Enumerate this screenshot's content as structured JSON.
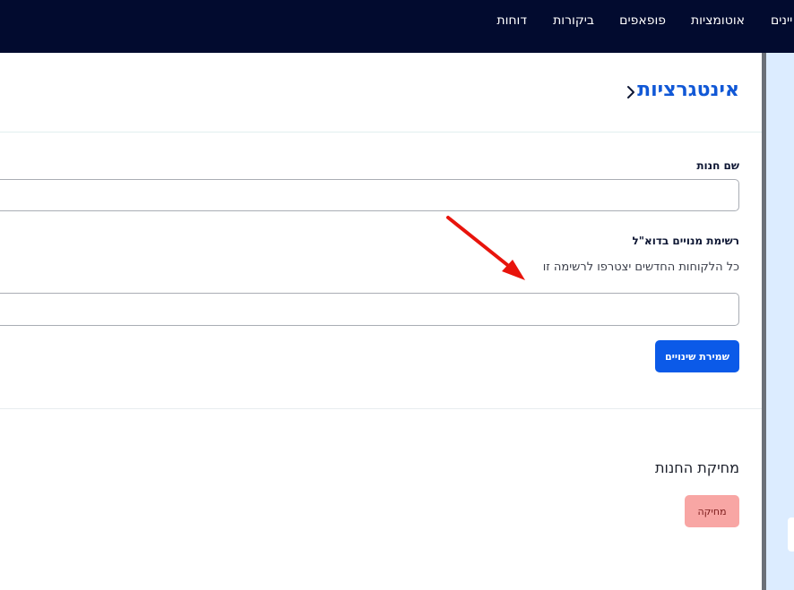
{
  "topnav": {
    "items": [
      {
        "label": "דוחות"
      },
      {
        "label": "ביקורות"
      },
      {
        "label": "פופאפים"
      },
      {
        "label": "אוטומציות"
      },
      {
        "label": "יינים"
      }
    ]
  },
  "page": {
    "title": "אינטגרציות"
  },
  "form": {
    "store_name_label": "שם חנות",
    "store_name_value": "",
    "subscribers_label": "רשימת מנויים בדוא\"ל",
    "subscribers_help": "כל הלקוחות החדשים יצטרפו לרשימה זו",
    "subscribers_value": "",
    "save_label": "שמירת שינויים"
  },
  "delete_section": {
    "title": "מחיקת החנות",
    "button_label": "מחיקה"
  },
  "colors": {
    "topbar": "#020b2f",
    "accent": "#0b5ae8",
    "title": "#1158d6",
    "danger_bg": "#f8a6a4",
    "annotation_arrow": "#e8140c"
  }
}
